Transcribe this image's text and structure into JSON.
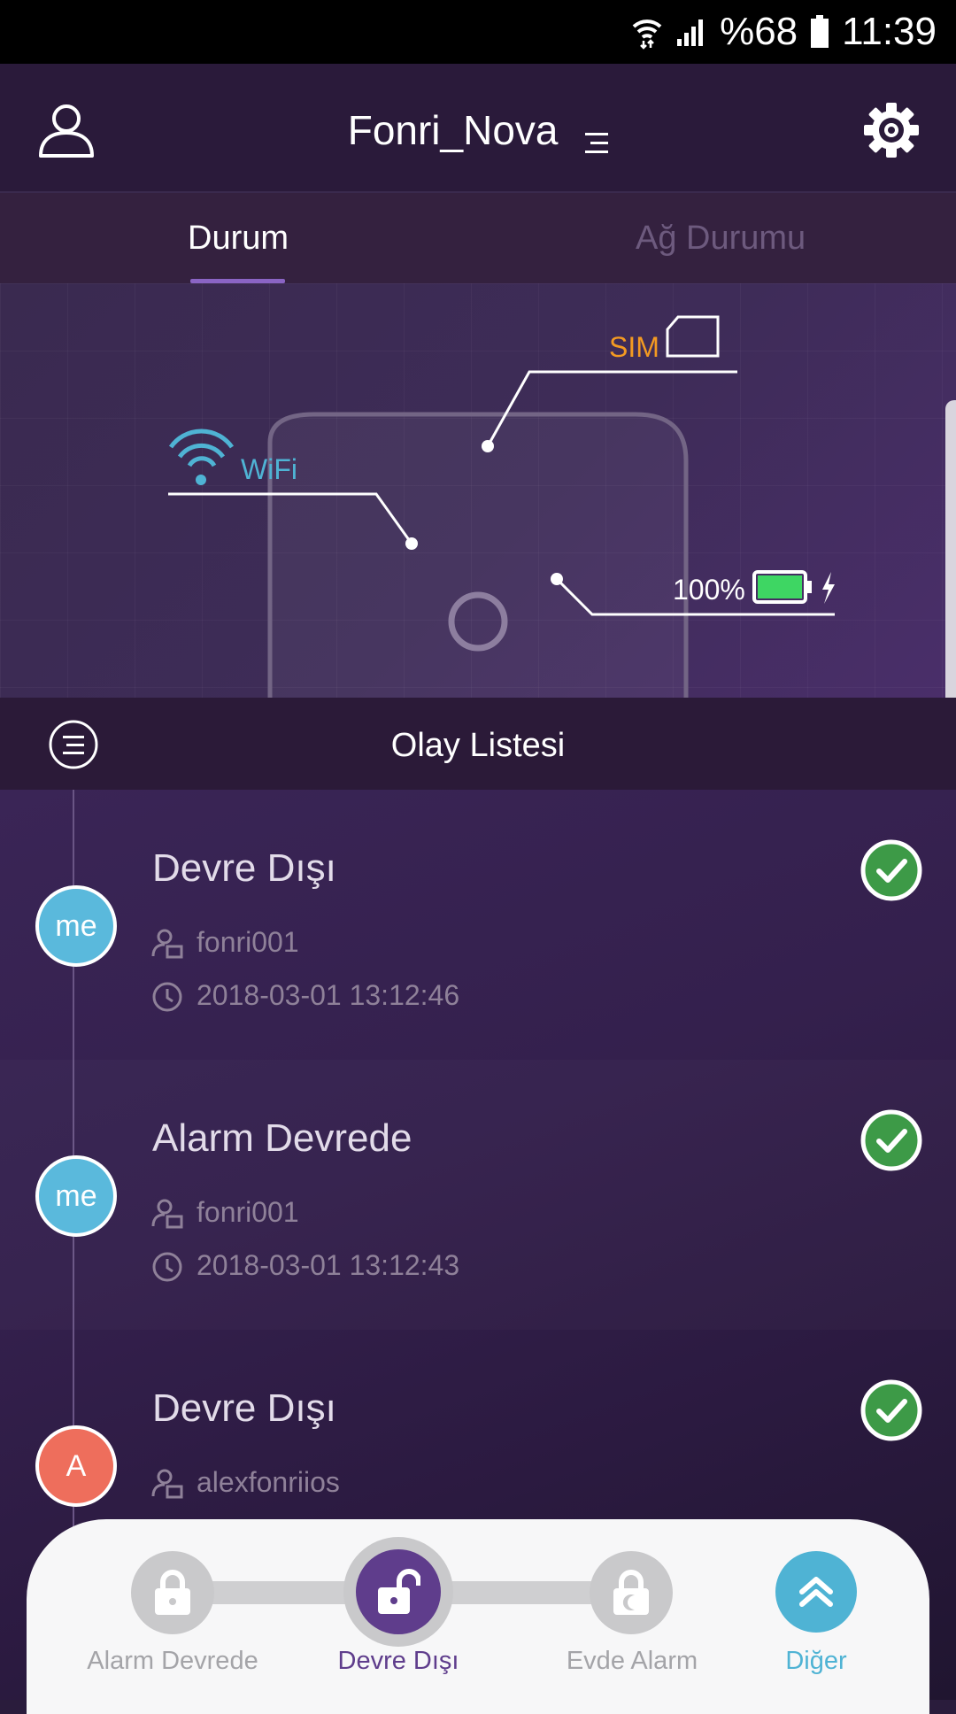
{
  "status_bar": {
    "battery": "%68",
    "time": "11:39"
  },
  "header": {
    "title": "Fonri_Nova"
  },
  "tabs": [
    {
      "label": "Durum",
      "active": true
    },
    {
      "label": "Ağ Durumu",
      "active": false
    }
  ],
  "device_status": {
    "wifi_label": "WiFi",
    "sim_label": "SIM",
    "battery_level": "100%",
    "colors": {
      "wifi": "#4fb3d4",
      "sim": "#f39a22",
      "battery": "#3ed663"
    }
  },
  "events_header": {
    "title": "Olay Listesi"
  },
  "events": [
    {
      "avatar": "me",
      "avatar_color": "#5ab9dc",
      "name": "Devre Dışı",
      "user": "fonri001",
      "time": "2018-03-01 13:12:46",
      "status": "check"
    },
    {
      "avatar": "me",
      "avatar_color": "#5ab9dc",
      "name": "Alarm Devrede",
      "user": "fonri001",
      "time": "2018-03-01 13:12:43",
      "status": "check"
    },
    {
      "avatar": "A",
      "avatar_color": "#ee6e5c",
      "name": "Devre Dışı",
      "user": "alexfonriios",
      "time": "",
      "status": "check"
    }
  ],
  "mode_bar": {
    "items": [
      {
        "label": "Alarm Devrede",
        "icon": "lock-icon",
        "active": false
      },
      {
        "label": "Devre Dışı",
        "icon": "unlock-icon",
        "active": true
      },
      {
        "label": "Evde Alarm",
        "icon": "home-lock-icon",
        "active": false
      },
      {
        "label": "Diğer",
        "icon": "double-chevron-up-icon",
        "active": false
      }
    ],
    "colors": {
      "active": "#5f3d8c",
      "inactive": "#c9c9cb",
      "more": "#4fb3d4"
    }
  }
}
